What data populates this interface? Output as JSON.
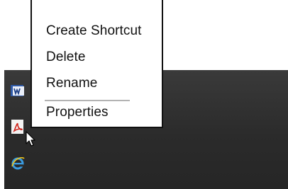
{
  "context_menu": {
    "items": [
      {
        "label": "Create Shortcut"
      },
      {
        "label": "Delete"
      },
      {
        "label": "Rename"
      },
      {
        "label": "Properties"
      }
    ]
  },
  "desktop": {
    "icons": [
      {
        "name": "word-icon"
      },
      {
        "name": "acrobat-icon"
      },
      {
        "name": "internet-explorer-icon"
      }
    ]
  },
  "colors": {
    "desktop_background": "#2b2b2b",
    "menu_background": "#ffffff",
    "menu_border": "#111111",
    "separator": "#b3b3b3"
  }
}
